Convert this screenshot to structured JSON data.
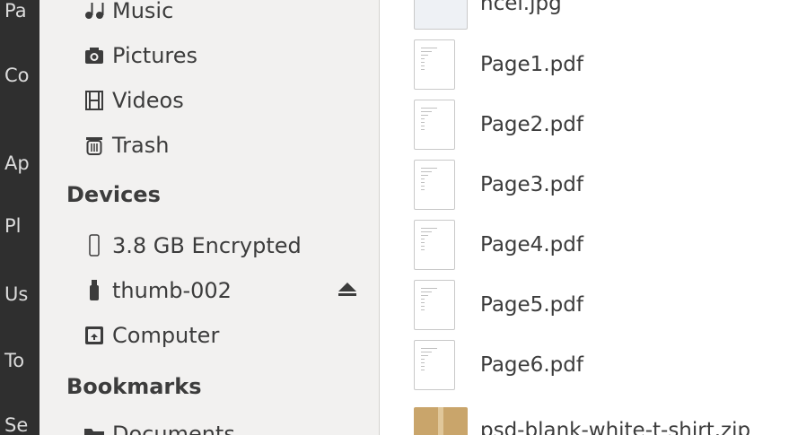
{
  "leftstrip": {
    "items": [
      "Pa",
      "Co",
      "Ap",
      "Pl",
      "Us",
      "To",
      "Se"
    ]
  },
  "sidebar": {
    "places": [
      {
        "label": "Music",
        "icon": "music-icon"
      },
      {
        "label": "Pictures",
        "icon": "camera-icon"
      },
      {
        "label": "Videos",
        "icon": "film-icon"
      },
      {
        "label": "Trash",
        "icon": "trash-icon"
      }
    ],
    "devices_heading": "Devices",
    "devices": [
      {
        "label": "3.8 GB Encrypted",
        "icon": "drive-icon"
      },
      {
        "label": "thumb-002",
        "icon": "usb-icon",
        "eject": true
      },
      {
        "label": "Computer",
        "icon": "computer-icon"
      }
    ],
    "bookmarks_heading": "Bookmarks",
    "bookmarks": [
      {
        "label": "Documents",
        "icon": "folder-icon"
      }
    ]
  },
  "files": [
    {
      "name": "ncel.jpg",
      "icon": "image-thumb-icon"
    },
    {
      "name": "Page1.pdf",
      "icon": "pdf-thumb-icon"
    },
    {
      "name": "Page2.pdf",
      "icon": "pdf-thumb-icon"
    },
    {
      "name": "Page3.pdf",
      "icon": "pdf-thumb-icon"
    },
    {
      "name": "Page4.pdf",
      "icon": "pdf-thumb-icon"
    },
    {
      "name": "Page5.pdf",
      "icon": "pdf-thumb-icon"
    },
    {
      "name": "Page6.pdf",
      "icon": "pdf-thumb-icon"
    },
    {
      "name": "psd-blank-white-t-shirt.zip",
      "icon": "archive-icon"
    }
  ]
}
